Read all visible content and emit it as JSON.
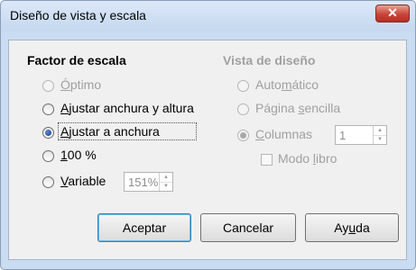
{
  "dialog": {
    "title": "Diseño de vista y escala",
    "close_glyph": "✕"
  },
  "scale_factor": {
    "heading": "Factor de escala",
    "options": [
      {
        "pre": "",
        "key": "Ó",
        "post": "ptimo",
        "selected": false,
        "enabled": false
      },
      {
        "pre": "",
        "key": "A",
        "post": "justar anchura y altura",
        "selected": false,
        "enabled": true
      },
      {
        "pre": "",
        "key": "A",
        "post": "justar a anchura",
        "selected": true,
        "enabled": true
      },
      {
        "pre": "",
        "key": "1",
        "post": "00 %",
        "selected": false,
        "enabled": true
      },
      {
        "pre": "",
        "key": "V",
        "post": "ariable",
        "selected": false,
        "enabled": true
      }
    ],
    "variable_value": "151%"
  },
  "view_layout": {
    "heading": "Vista de diseño",
    "automatic": {
      "pre": "Auto",
      "key": "m",
      "post": "ático"
    },
    "single_page": {
      "pre": "Página ",
      "key": "s",
      "post": "encilla"
    },
    "columns": {
      "pre": "",
      "key": "C",
      "post": "olumnas",
      "value": "1"
    },
    "book_mode": {
      "pre": "Modo ",
      "key": "l",
      "post": "ibro",
      "checked": false
    }
  },
  "buttons": {
    "ok": "Aceptar",
    "cancel": "Cancelar",
    "help": {
      "pre": "Ay",
      "key": "u",
      "post": "da"
    }
  },
  "colors": {
    "title_bar": "#c9dcf2",
    "close": "#c8453a",
    "disabled_text": "#a0a0a0",
    "default_button": "#3c7fb1"
  }
}
